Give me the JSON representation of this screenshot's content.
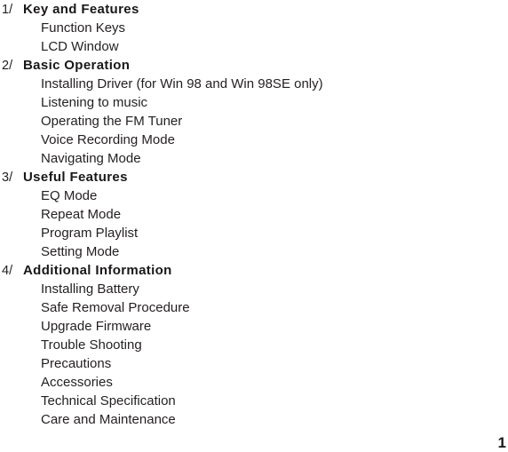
{
  "document": {
    "page_number": "1",
    "sections": [
      {
        "number": "1/",
        "heading": "Key and Features",
        "items": [
          "Function Keys",
          "LCD Window"
        ]
      },
      {
        "number": "2/",
        "heading": "Basic Operation",
        "items": [
          "Installing Driver (for Win 98 and Win 98SE only)",
          "Listening to music",
          "Operating the FM Tuner",
          "Voice Recording Mode",
          "Navigating Mode"
        ]
      },
      {
        "number": "3/",
        "heading": "Useful Features",
        "items": [
          "EQ Mode",
          "Repeat Mode",
          "Program Playlist",
          "Setting Mode"
        ]
      },
      {
        "number": "4/",
        "heading": "Additional Information",
        "items": [
          "Installing Battery",
          "Safe Removal Procedure",
          "Upgrade Firmware",
          "Trouble Shooting",
          "Precautions",
          "Accessories",
          "Technical Specification",
          "Care and Maintenance"
        ]
      }
    ]
  }
}
